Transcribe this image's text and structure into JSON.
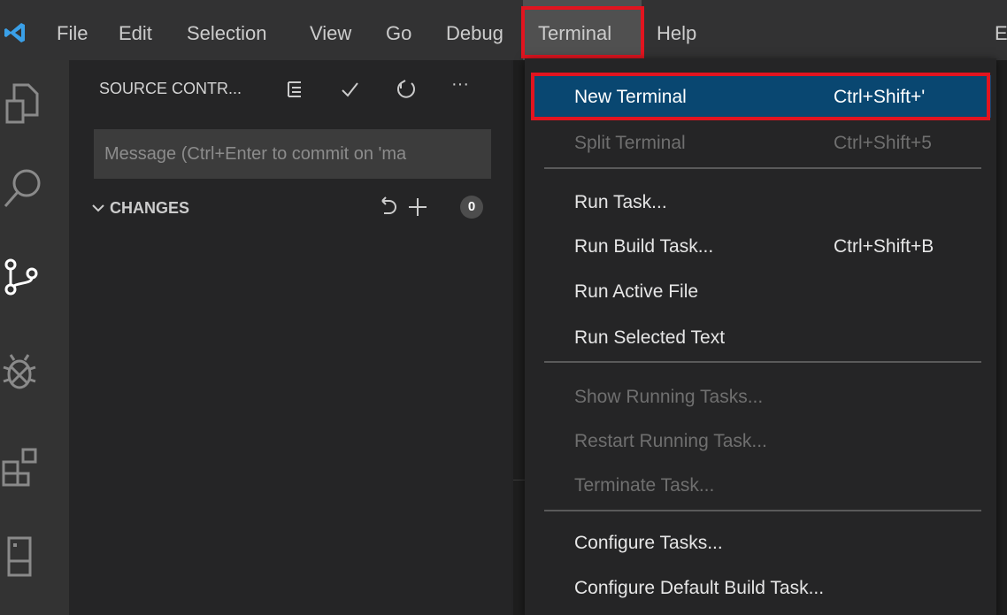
{
  "menubar": {
    "items": [
      "File",
      "Edit",
      "Selection",
      "View",
      "Go",
      "Debug",
      "Terminal",
      "Help"
    ],
    "clipped_right": "E"
  },
  "sidebar": {
    "title": "SOURCE CONTR...",
    "message_placeholder": "Message (Ctrl+Enter to commit on 'ma",
    "changes_label": "CHANGES",
    "changes_count": "0"
  },
  "activitybar": {
    "icons": [
      "explorer-icon",
      "search-icon",
      "source-control-icon",
      "debug-icon",
      "extensions-icon",
      "remote-explorer-icon"
    ]
  },
  "terminal_menu": {
    "items": [
      {
        "label": "New Terminal",
        "shortcut": "Ctrl+Shift+'"
      },
      {
        "label": "Split Terminal",
        "shortcut": "Ctrl+Shift+5"
      },
      {
        "label": "Run Task...",
        "shortcut": ""
      },
      {
        "label": "Run Build Task...",
        "shortcut": "Ctrl+Shift+B"
      },
      {
        "label": "Run Active File",
        "shortcut": ""
      },
      {
        "label": "Run Selected Text",
        "shortcut": ""
      },
      {
        "label": "Show Running Tasks...",
        "shortcut": ""
      },
      {
        "label": "Restart Running Task...",
        "shortcut": ""
      },
      {
        "label": "Terminate Task...",
        "shortcut": ""
      },
      {
        "label": "Configure Tasks...",
        "shortcut": ""
      },
      {
        "label": "Configure Default Build Task...",
        "shortcut": ""
      }
    ]
  },
  "colors": {
    "highlight": "#e2141f",
    "selected": "#094771",
    "accent": "#007acc"
  }
}
